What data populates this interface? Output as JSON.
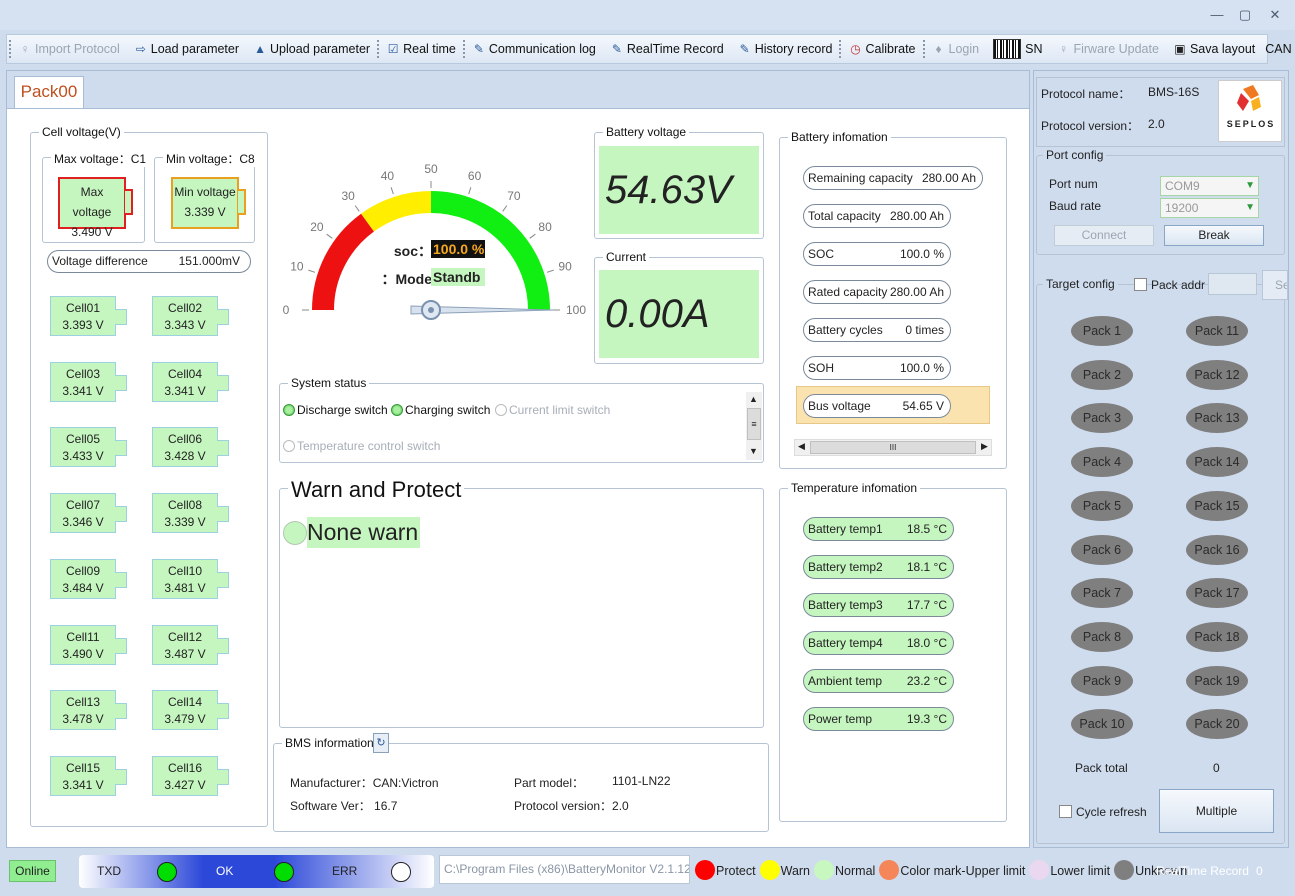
{
  "window": {
    "minimize": "▭",
    "restore": "▢",
    "close": "✕"
  },
  "toolbar": {
    "import_protocol": "Import Protocol",
    "load_parameter": "Load parameter",
    "upload_parameter": "Upload parameter",
    "real_time": "Real time",
    "communication_log": "Communication log",
    "realtime_record": "RealTime Record",
    "history_record": "History record",
    "calibrate": "Calibrate",
    "login": "Login",
    "sn": "SN",
    "firmware_update": "Firware Update",
    "save_layout": "Sava layout",
    "can": "CAN"
  },
  "tab": {
    "label": "Pack00"
  },
  "cell_voltage": {
    "title": "Cell voltage(V)",
    "max_title": "Max voltage：C1",
    "max_label": "Max voltage",
    "max_value": "3.490 V",
    "min_title": "Min voltage：C8",
    "min_label": "Min voltage",
    "min_value": "3.339 V",
    "diff_label": "Voltage difference",
    "diff_value": "151.000mV",
    "cells": [
      {
        "name": "Cell01",
        "value": "3.393 V"
      },
      {
        "name": "Cell02",
        "value": "3.343 V"
      },
      {
        "name": "Cell03",
        "value": "3.341 V"
      },
      {
        "name": "Cell04",
        "value": "3.341 V"
      },
      {
        "name": "Cell05",
        "value": "3.433 V"
      },
      {
        "name": "Cell06",
        "value": "3.428 V"
      },
      {
        "name": "Cell07",
        "value": "3.346 V"
      },
      {
        "name": "Cell08",
        "value": "3.339 V"
      },
      {
        "name": "Cell09",
        "value": "3.484 V"
      },
      {
        "name": "Cell10",
        "value": "3.481 V"
      },
      {
        "name": "Cell11",
        "value": "3.490 V"
      },
      {
        "name": "Cell12",
        "value": "3.487 V"
      },
      {
        "name": "Cell13",
        "value": "3.478 V"
      },
      {
        "name": "Cell14",
        "value": "3.479 V"
      },
      {
        "name": "Cell15",
        "value": "3.341 V"
      },
      {
        "name": "Cell16",
        "value": "3.427 V"
      }
    ]
  },
  "gauge": {
    "ticks": [
      "0",
      "10",
      "20",
      "30",
      "40",
      "50",
      "60",
      "70",
      "80",
      "90",
      "100"
    ],
    "soc_label": "soc：",
    "soc_value": "100.0 %",
    "mode_label": "Mode：",
    "mode_value": "Standb",
    "needle_value": 100,
    "colors": {
      "red": "#ee1111",
      "yellow": "#ffee00",
      "green": "#11ee11"
    }
  },
  "battery_voltage": {
    "title": "Battery voltage",
    "value": "54.63V"
  },
  "current": {
    "title": "Current",
    "value": "0.00A"
  },
  "battery_info": {
    "title": "Battery infomation",
    "items": [
      {
        "label": "Remaining capacity",
        "value": "280.00 Ah"
      },
      {
        "label": "Total capacity",
        "value": "280.00 Ah"
      },
      {
        "label": "SOC",
        "value": "100.0 %"
      },
      {
        "label": "Rated capacity",
        "value": "280.00 Ah"
      },
      {
        "label": "Battery cycles",
        "value": "0 times"
      },
      {
        "label": "SOH",
        "value": "100.0 %"
      },
      {
        "label": "Bus voltage",
        "value": "54.65 V"
      }
    ],
    "scroll_thumb": "III"
  },
  "system_status": {
    "title": "System status",
    "items": [
      {
        "label": "Discharge switch",
        "on": true
      },
      {
        "label": "Charging switch",
        "on": true
      },
      {
        "label": "Current limit switch",
        "on": false
      },
      {
        "label": "Temperature control switch",
        "on": false
      }
    ]
  },
  "warn": {
    "title": "Warn and Protect",
    "status": "None warn"
  },
  "temperature_info": {
    "title": "Temperature infomation",
    "items": [
      {
        "label": "Battery temp1",
        "value": "18.5 °C"
      },
      {
        "label": "Battery temp2",
        "value": "18.1 °C"
      },
      {
        "label": "Battery temp3",
        "value": "17.7 °C"
      },
      {
        "label": "Battery temp4",
        "value": "18.0 °C"
      },
      {
        "label": "Ambient temp",
        "value": "23.2 °C"
      },
      {
        "label": "Power temp",
        "value": "19.3 °C"
      }
    ]
  },
  "bms_info": {
    "title": "BMS information",
    "manufacturer_label": "Manufacturer：",
    "manufacturer": "CAN:Victron",
    "part_model_label": "Part model：",
    "part_model": "1101-LN22",
    "software_label": "Software Ver：",
    "software": "16.7",
    "protocol_label": "Protocol version：",
    "protocol": "2.0"
  },
  "right_panel": {
    "protocol_name_label": "Protocol name：",
    "protocol_name": "BMS-16S",
    "protocol_version_label": "Protocol version：",
    "protocol_version": "2.0",
    "logo_text": "SEPLOS",
    "port_config_title": "Port config",
    "port_num_label": "Port num",
    "port_num": "COM9",
    "baud_label": "Baud rate",
    "baud": "19200",
    "connect": "Connect",
    "break": "Break",
    "target_title": "Target config",
    "pack_addr_label": "Pack addr",
    "se_label": "Se",
    "packs": [
      "Pack 1",
      "Pack 11",
      "Pack 2",
      "Pack 12",
      "Pack 3",
      "Pack 13",
      "Pack 4",
      "Pack 14",
      "Pack 5",
      "Pack 15",
      "Pack 6",
      "Pack 16",
      "Pack 7",
      "Pack 17",
      "Pack 8",
      "Pack 18",
      "Pack 9",
      "Pack 19",
      "Pack 10",
      "Pack 20"
    ],
    "pack_total_label": "Pack total",
    "pack_total": "0",
    "cycle_refresh": "Cycle refresh",
    "multiple": "Multiple"
  },
  "status_bar": {
    "online": "Online",
    "txd": "TXD",
    "ok": "OK",
    "err": "ERR",
    "path": "C:\\Program Files (x86)\\BatteryMonitor V2.1.12",
    "legend": [
      {
        "label": "Protect",
        "color": "#ff0000"
      },
      {
        "label": "Warn",
        "color": "#ffff00"
      },
      {
        "label": "Normal",
        "color": "#c8f8c0"
      },
      {
        "label": "Color mark-Upper limit",
        "color": "#f5865a"
      },
      {
        "label": "Lower limit",
        "color": "#ead8f0"
      },
      {
        "label": "Unknown",
        "color": "#7f7f7f"
      }
    ],
    "realtime_record": "RealTime Record",
    "record_count": "0"
  }
}
